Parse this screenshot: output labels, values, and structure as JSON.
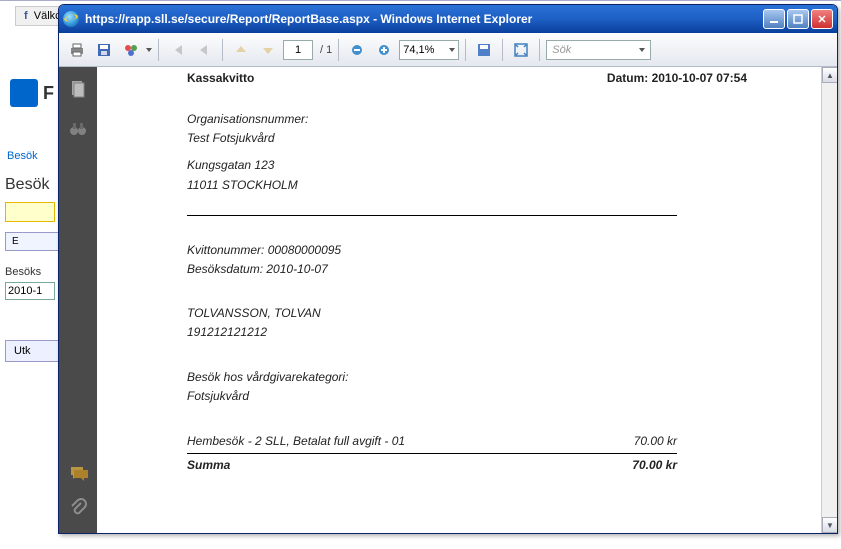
{
  "background": {
    "tab": "Välkc",
    "logo_text": "F",
    "link1": "Besök",
    "heading": "Besök",
    "row_btn": "E",
    "label_visit": "Besöks",
    "date_val": "2010-1",
    "util_btn": "Utk"
  },
  "window": {
    "title": "https://rapp.sll.se/secure/Report/ReportBase.aspx - Windows Internet Explorer"
  },
  "toolbar": {
    "page_current": "1",
    "page_total": "/ 1",
    "zoom": "74,1%",
    "search_placeholder": "Sök"
  },
  "report": {
    "title": "Kassakvitto",
    "date": "Datum: 2010-10-07 07:54",
    "orgnr_label": "Organisationsnummer:",
    "org_name": "Test Fotsjukvård",
    "address1": "Kungsgatan 123",
    "address2": "11011 STOCKHOLM",
    "receipt_no": "Kvittonummer: 00080000095",
    "visit_date": "Besöksdatum: 2010-10-07",
    "patient_name": "TOLVANSSON, TOLVAN",
    "patient_id": "191212121212",
    "category_label": "Besök hos vårdgivarekategori:",
    "category_value": "Fotsjukvård",
    "line_item": "Hembesök - 2 SLL, Betalat full avgift - 01",
    "line_amount": "70.00 kr",
    "sum_label": "Summa",
    "sum_amount": "70.00 kr"
  }
}
